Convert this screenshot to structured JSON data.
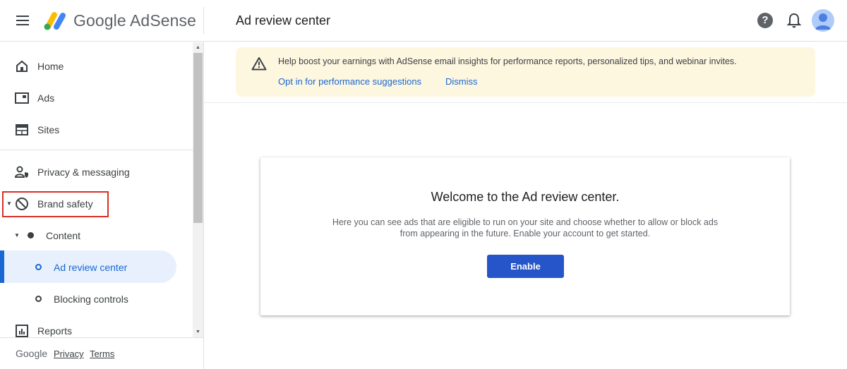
{
  "header": {
    "brand": "Google AdSense",
    "page_title": "Ad review center",
    "help_glyph": "?",
    "icons": [
      "menu-icon",
      "adsense-logo",
      "help-icon",
      "notifications-bell-icon",
      "account-avatar"
    ]
  },
  "sidebar": {
    "items": [
      {
        "label": "Home",
        "icon": "home-icon"
      },
      {
        "label": "Ads",
        "icon": "ads-icon"
      },
      {
        "label": "Sites",
        "icon": "sites-icon"
      },
      {
        "label": "Privacy & messaging",
        "icon": "privacy-messaging-icon"
      },
      {
        "label": "Brand safety",
        "icon": "block-icon",
        "expanded": true,
        "highlighted": true
      },
      {
        "label": "Content",
        "icon": "bullet-filled-icon",
        "expanded": true
      },
      {
        "label": "Ad review center",
        "icon": "bullet-ring-icon",
        "active": true
      },
      {
        "label": "Blocking controls",
        "icon": "bullet-ring-icon"
      },
      {
        "label": "Reports",
        "icon": "reports-icon"
      }
    ],
    "footer": {
      "google": "Google",
      "privacy": "Privacy",
      "terms": "Terms"
    }
  },
  "banner": {
    "message": "Help boost your earnings with AdSense email insights for performance reports, personalized tips, and webinar invites.",
    "opt_in": "Opt in for performance suggestions",
    "dismiss": "Dismiss"
  },
  "card": {
    "title": "Welcome to the Ad review center.",
    "description": "Here you can see ads that are eligible to run on your site and choose whether to allow or block ads from appearing in the future. Enable your account to get started.",
    "button": "Enable"
  },
  "colors": {
    "accent_blue": "#1967d2",
    "button_blue": "#2655c9",
    "banner_bg": "#fef7e0",
    "active_bg": "#e8f0fe",
    "highlight_red": "#d93025"
  }
}
